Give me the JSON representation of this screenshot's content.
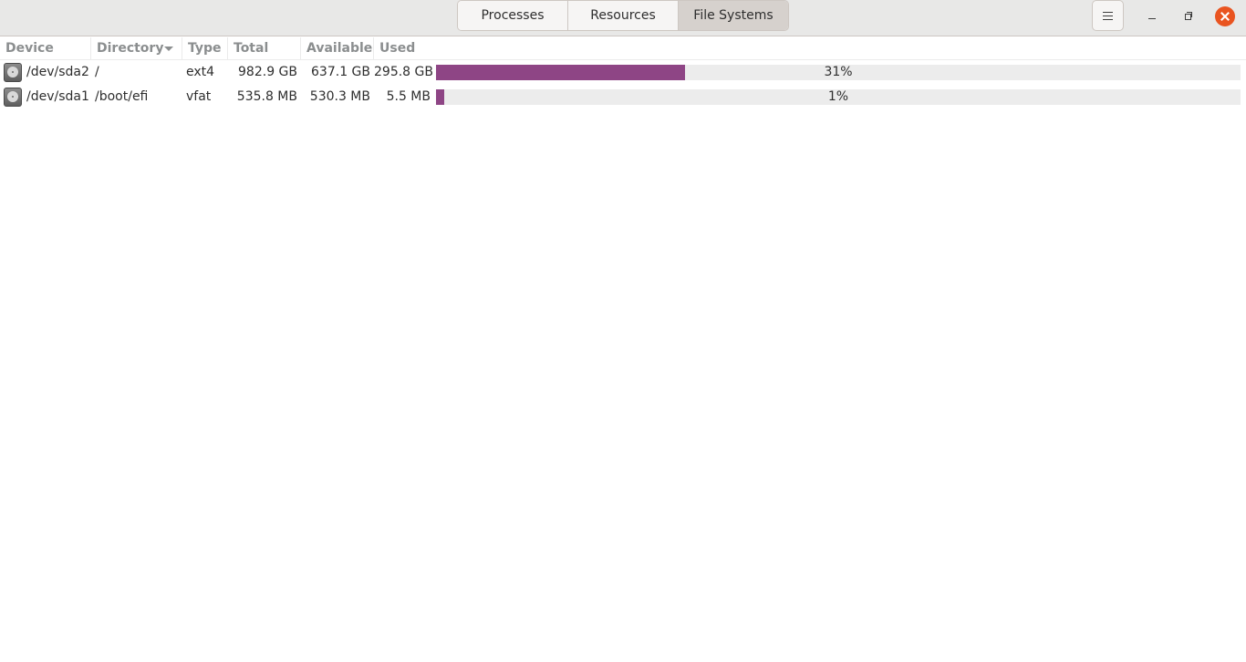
{
  "header": {
    "tabs": [
      {
        "label": "Processes",
        "active": false
      },
      {
        "label": "Resources",
        "active": false
      },
      {
        "label": "File Systems",
        "active": true
      }
    ],
    "menu_icon": "hamburger-menu-icon",
    "window_controls": [
      "minimize-icon",
      "maximize-icon",
      "close-icon"
    ]
  },
  "colors": {
    "accent_bar": "#8e4585",
    "close_button": "#e95420",
    "bar_track": "#ececec"
  },
  "table": {
    "columns": [
      "Device",
      "Directory",
      "Type",
      "Total",
      "Available",
      "Used"
    ],
    "sorted_by": "Directory",
    "rows": [
      {
        "icon": "drive-harddisk-icon",
        "device": "/dev/sda2",
        "directory": "/",
        "type": "ext4",
        "total": "982.9 GB",
        "available": "637.1 GB",
        "used": "295.8 GB",
        "used_percent": 31,
        "used_percent_label": "31%"
      },
      {
        "icon": "drive-harddisk-icon",
        "device": "/dev/sda1",
        "directory": "/boot/efi",
        "type": "vfat",
        "total": "535.8 MB",
        "available": "530.3 MB",
        "used": "5.5 MB",
        "used_percent": 1,
        "used_percent_label": "1%"
      }
    ]
  }
}
